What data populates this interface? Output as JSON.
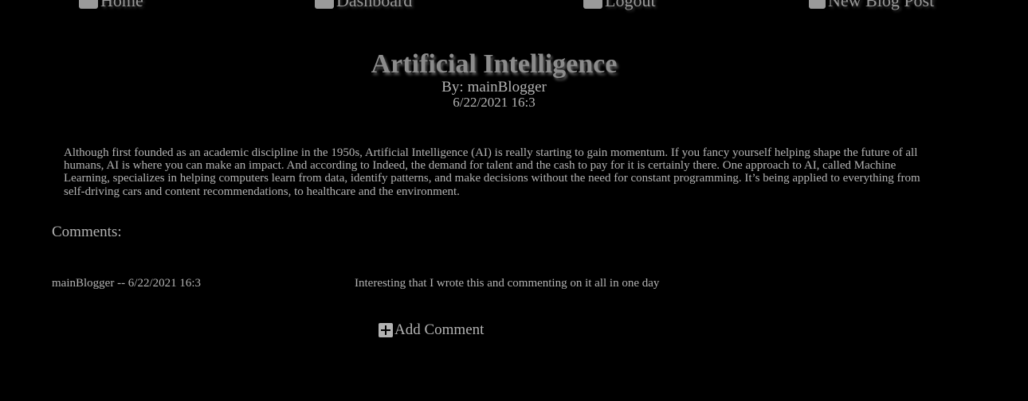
{
  "nav": {
    "home_label": "Home",
    "dashboard_label": "Dashboard",
    "logout_label": "Logout",
    "new_post_label": "New Blog Post",
    "home_icon": "home-icon",
    "dashboard_icon": "dashboard-icon",
    "logout_icon": "logout-icon",
    "new_post_icon": "plus-square-icon"
  },
  "post": {
    "title": "Artificial Intelligence",
    "author_prefix": "By:",
    "author": "mainBlogger",
    "date": "6/22/2021 16:3",
    "body": "Although first founded as an academic discipline in the 1950s, Artificial Intelligence (AI) is really starting to gain momentum. If you fancy yourself helping shape the future of all humans, AI is where you can make an impact. And according to Indeed, the demand for talent and the cash to pay for it is certainly there. One approach to AI, called Machine Learning, specializes in helping computers learn from data, identify patterns, and make decisions without the need for constant programming. It’s being applied to everything from self-driving cars and content recommendations, to healthcare and the environment."
  },
  "comments": {
    "heading": "Comments:",
    "items": [
      {
        "meta": "mainBlogger -- 6/22/2021 16:3",
        "text": "Interesting that I wrote this and commenting on it all in one day"
      }
    ],
    "add_label": "Add Comment",
    "add_icon": "plus-square-icon"
  },
  "colors": {
    "background": "#000000",
    "text": "#b3b3b3",
    "title": "#8c8c8c",
    "nav": "#9a9a9a"
  }
}
